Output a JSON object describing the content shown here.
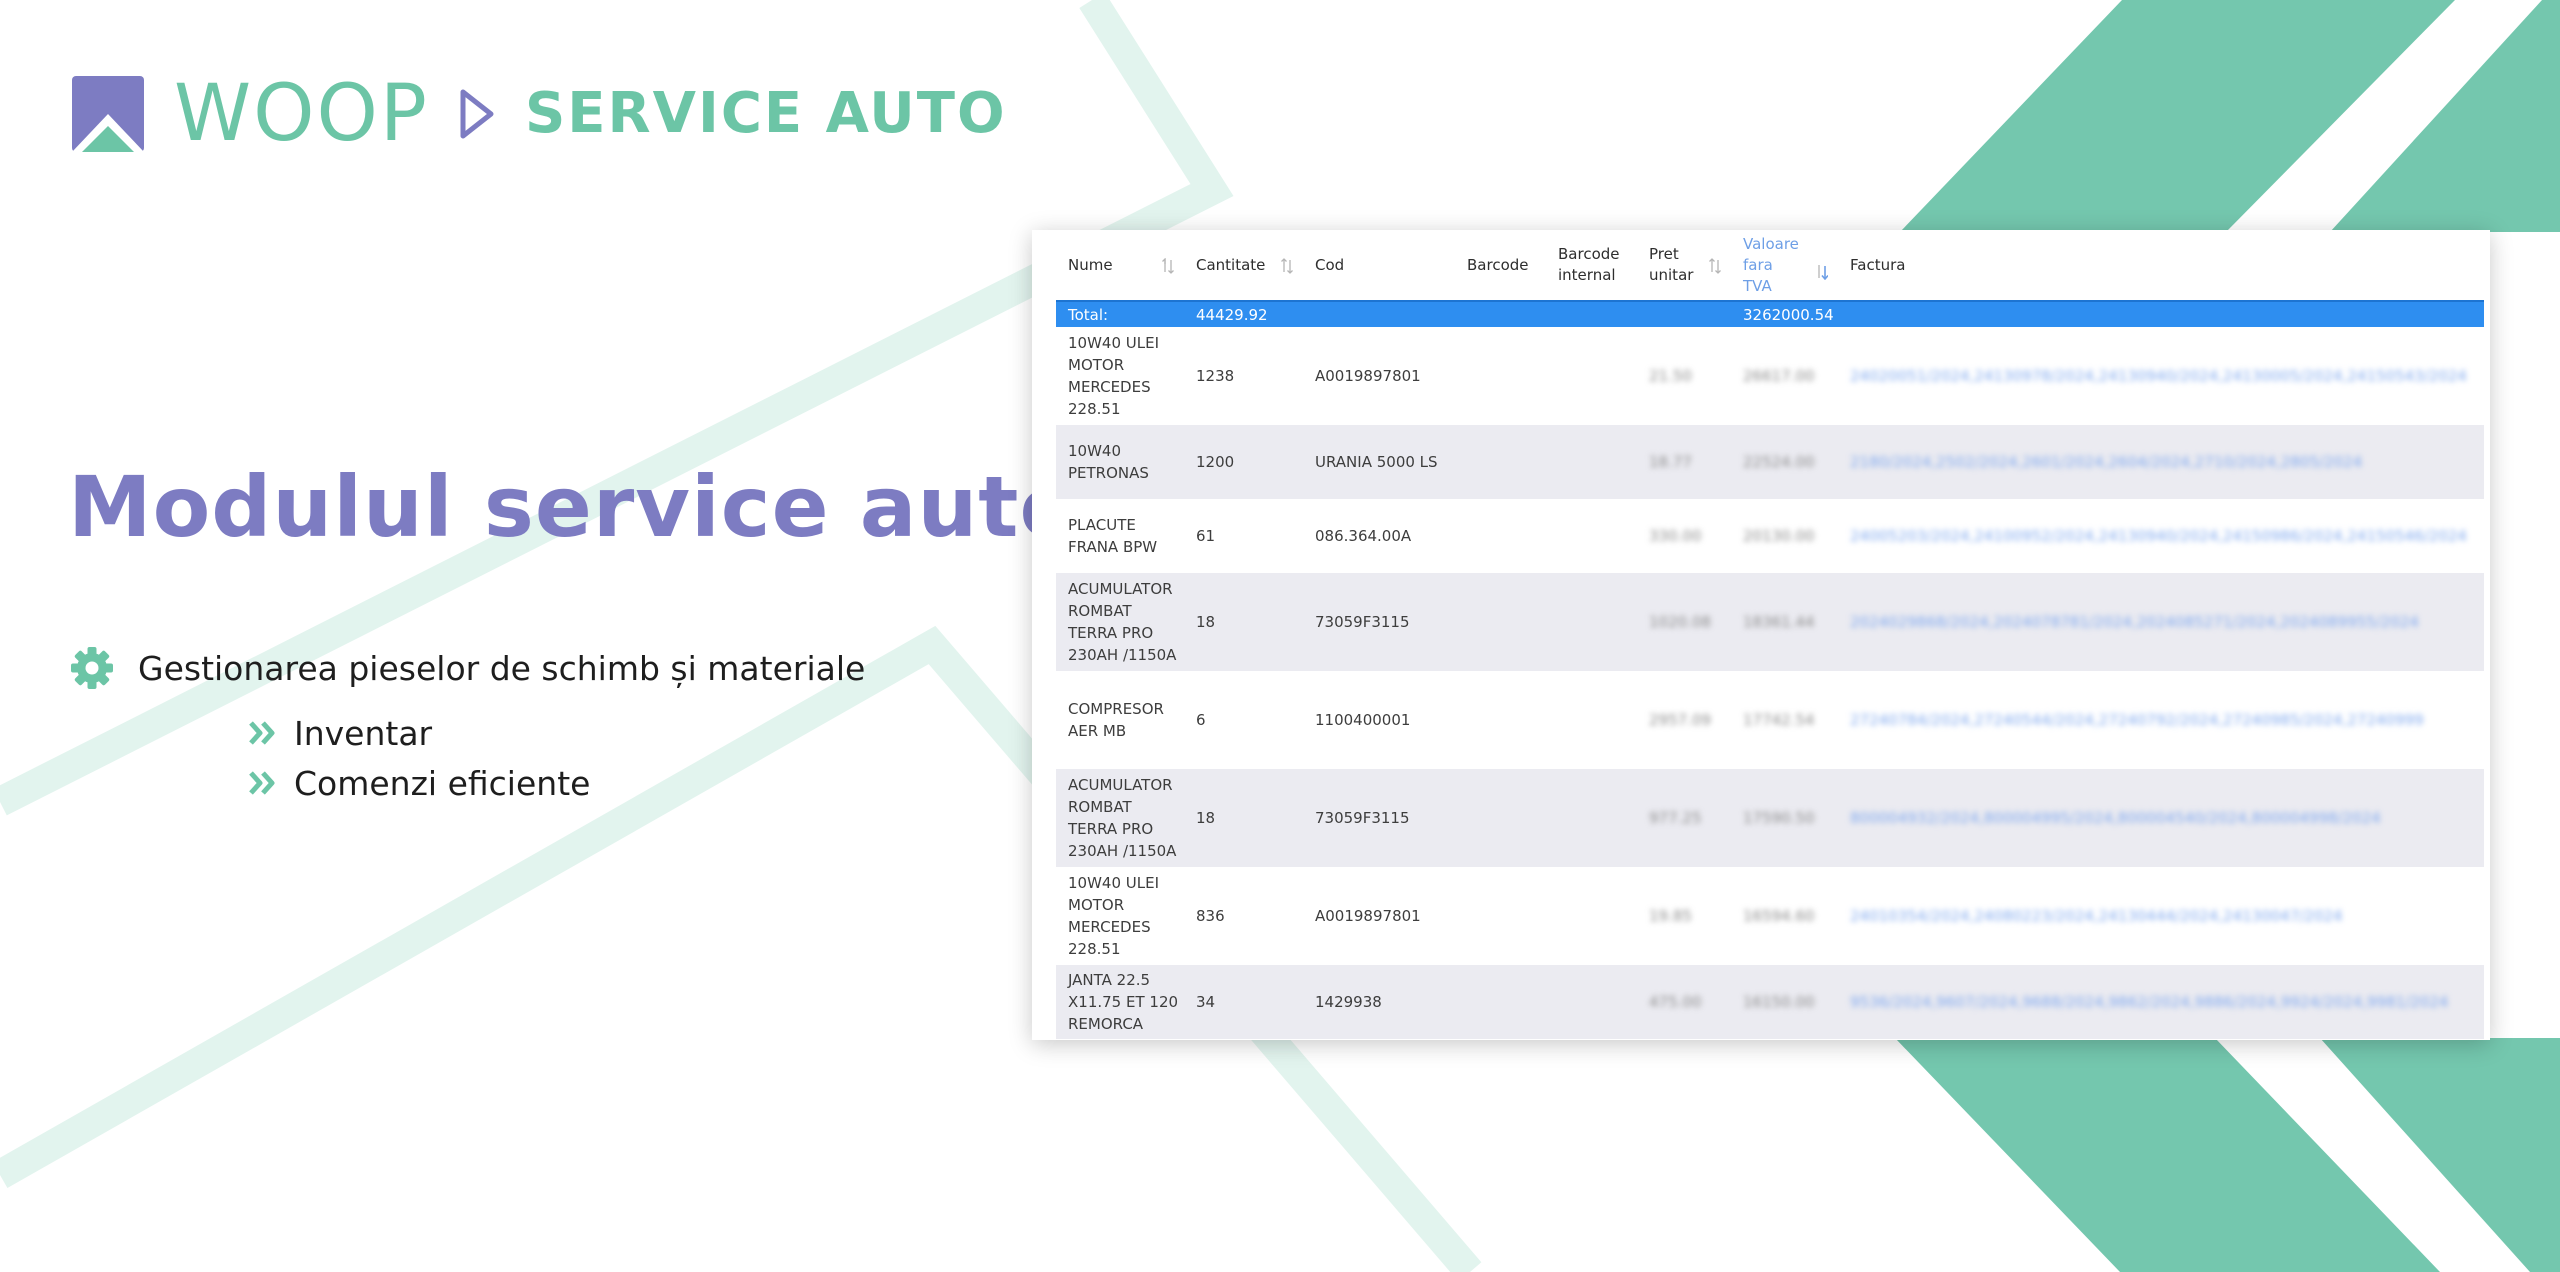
{
  "brand": {
    "name": "WOOP",
    "subtitle": "SERVICE AUTO"
  },
  "headline": "Modulul service auto",
  "feature": {
    "label": "Gestionarea pieselor de schimb și materiale",
    "items": [
      {
        "label": "Inventar"
      },
      {
        "label": "Comenzi eficiente"
      }
    ]
  },
  "colors": {
    "green": "#6cc5a6",
    "purple": "#7d7cc2",
    "total_row": "#2e8ef0"
  },
  "table": {
    "headers": {
      "nume": "Nume",
      "cantitate": "Cantitate",
      "cod": "Cod",
      "barcode": "Barcode",
      "barcode_internal": "Barcode\ninternal",
      "pret_unitar": "Pret\nunitar",
      "valoare": "Valoare\nfara\nTVA",
      "factura": "Factura"
    },
    "total": {
      "label": "Total:",
      "cantitate": "44429.92",
      "valoare": "3262000.54"
    },
    "rows": [
      {
        "nume": "10W40 ULEI\nMOTOR\nMERCEDES\n228.51",
        "cantitate": "1238",
        "cod": "A0019897801",
        "pret": "21.50",
        "valoare": "26617.00",
        "factura": "24020051/2024,24130978/2024,24130940/2024,24130005/2024,24150543/2024"
      },
      {
        "nume": "10W40\nPETRONAS",
        "cantitate": "1200",
        "cod": "URANIA 5000 LS",
        "pret": "18.77",
        "valoare": "22524.00",
        "factura": "2180/2024,2502/2024,2601/2024,2604/2024,2710/2024,2805/2024"
      },
      {
        "nume": "PLACUTE\nFRANA BPW",
        "cantitate": "61",
        "cod": "086.364.00A",
        "pret": "330.00",
        "valoare": "20130.00",
        "factura": "24005203/2024,24100952/2024,24130940/2024,24150986/2024,24150546/2024"
      },
      {
        "nume": "ACUMULATOR\nROMBAT\nTERRA PRO\n230AH /1150A",
        "cantitate": "18",
        "cod": "73059F3115",
        "pret": "1020.08",
        "valoare": "18361.44",
        "factura": "2024029868/2024,2024078781/2024,2024085271/2024,2024089955/2024"
      },
      {
        "nume": "COMPRESOR\nAER MB",
        "cantitate": "6",
        "cod": "1100400001",
        "pret": "2957.09",
        "valoare": "17742.54",
        "factura": "27240784/2024,27240544/2024,27240792/2024,27240985/2024,27240999"
      },
      {
        "nume": "ACUMULATOR\nROMBAT\nTERRA PRO\n230AH /1150A",
        "cantitate": "18",
        "cod": "73059F3115",
        "pret": "977.25",
        "valoare": "17590.50",
        "factura": "800004932/2024,800004995/2024,800004540/2024,800004998/2024"
      },
      {
        "nume": "10W40 ULEI\nMOTOR\nMERCEDES\n228.51",
        "cantitate": "836",
        "cod": "A0019897801",
        "pret": "19.85",
        "valoare": "16594.60",
        "factura": "24010354/2024,24080223/2024,24130444/2024,24130047/2024"
      },
      {
        "nume": "JANTA 22.5\nX11.75 ET 120\nREMORCA",
        "cantitate": "34",
        "cod": "1429938",
        "pret": "475.00",
        "valoare": "16150.00",
        "factura": "9536/2024,9607/2024,9688/2024,9862/2024,9886/2024,9924/2024,9981/2024"
      }
    ]
  }
}
